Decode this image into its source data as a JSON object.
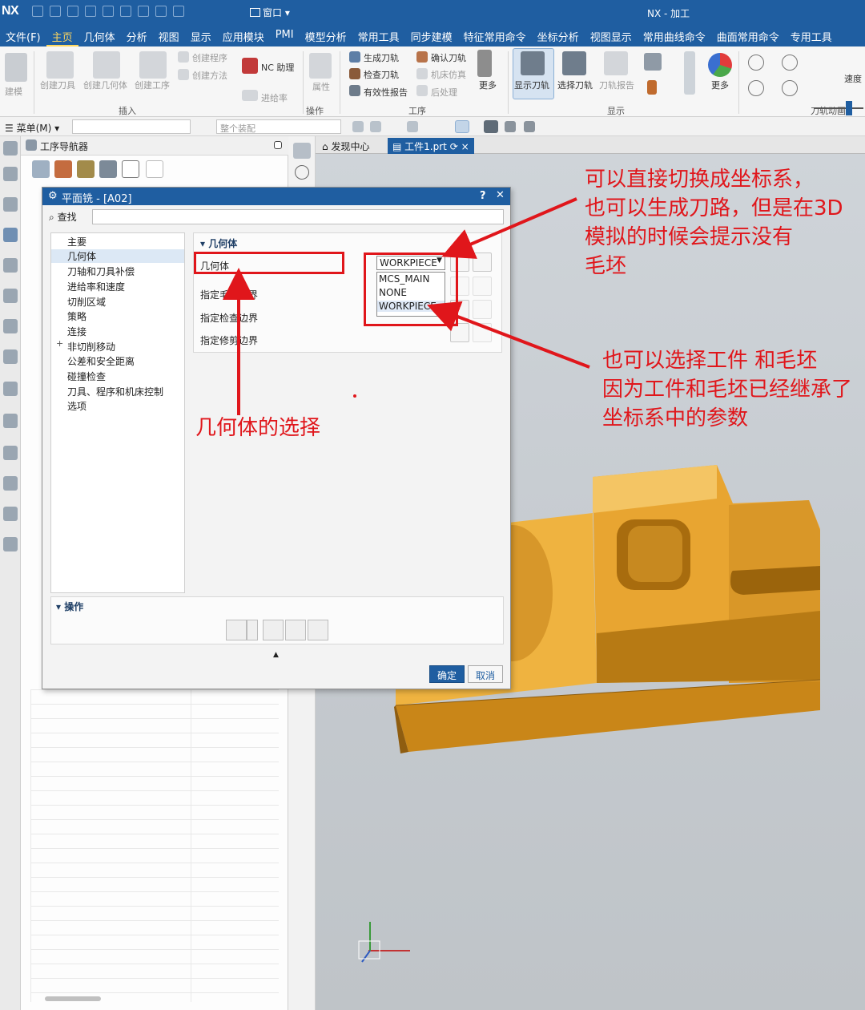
{
  "window": {
    "logo": "NX",
    "window_menu": "窗口",
    "app_title": "NX - 加工"
  },
  "menubar": [
    "文件(F)",
    "主页",
    "几何体",
    "分析",
    "视图",
    "显示",
    "应用模块",
    "PMI",
    "模型分析",
    "常用工具",
    "同步建模",
    "特征常用命令",
    "坐标分析",
    "视图显示",
    "常用曲线命令",
    "曲面常用命令",
    "专用工具"
  ],
  "ribbon": {
    "insert": {
      "group": "插入",
      "items": [
        "建模",
        "创建刀具",
        "创建几何体",
        "创建工序",
        "创建程序",
        "创建方法",
        "NC 助理",
        "进给率"
      ]
    },
    "operation": {
      "group": "操作",
      "items": [
        "属性"
      ]
    },
    "procedure": {
      "group": "工序",
      "items": [
        "生成刀轨",
        "确认刀轨",
        "检查刀轨",
        "机床仿真",
        "有效性报告",
        "后处理",
        "更多"
      ]
    },
    "display": {
      "group": "显示",
      "items": [
        "显示刀轨",
        "选择刀轨",
        "刀轨报告",
        "更多"
      ]
    },
    "animation": {
      "group": "刀轨动画",
      "speed": "速度"
    }
  },
  "cmdbar": {
    "menu": "菜单(M)",
    "filter_value": "整个装配"
  },
  "navigator": {
    "title": "工序导航器"
  },
  "tabs": [
    {
      "label": "发现中心"
    },
    {
      "label": "工件1.prt"
    }
  ],
  "dialog": {
    "title": "平面铣 - [A02]",
    "find_label": "查找",
    "tree": [
      "主要",
      "几何体",
      "刀轴和刀具补偿",
      "进给率和速度",
      "切削区域",
      "策略",
      "连接",
      "非切削移动",
      "公差和安全距离",
      "碰撞检查",
      "刀具、程序和机床控制",
      "选项"
    ],
    "geometry_section": "几何体",
    "geometry_field_label": "几何体",
    "field_labels": [
      "指定毛坯边界",
      "指定检查边界",
      "指定修剪边界"
    ],
    "geometry_value": "WORKPIECE",
    "geometry_options": [
      "MCS_MAIN",
      "NONE",
      "WORKPIECE"
    ],
    "operation_section": "操作",
    "ok": "确定",
    "cancel": "取消"
  },
  "annotations": {
    "top_right": [
      "可以直接切换成坐标系，",
      "也可以生成刀路，但是在3D",
      "模拟的时候会提示没有",
      "毛坯"
    ],
    "middle_right": [
      "也可以选择工件 和毛坯",
      "因为工件和毛坯已经继承了",
      "坐标系中的参数"
    ],
    "bottom": "几何体的选择"
  },
  "colors": {
    "title_blue": "#1f5ea1",
    "annotation_red": "#e0161b",
    "part_orange": "#e9a937"
  }
}
